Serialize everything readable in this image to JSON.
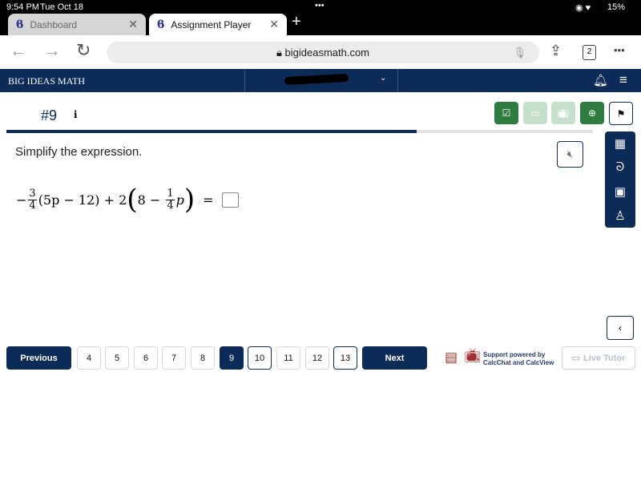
{
  "status_bar": {
    "time": "9:54 PM",
    "date": "Tue Oct 18",
    "battery": "15%"
  },
  "tabs": [
    {
      "label": "Dashboard",
      "active": false
    },
    {
      "label": "Assignment Player",
      "active": true
    }
  ],
  "address_bar": {
    "url": "bigideasmath.com",
    "tab_count": "2"
  },
  "header": {
    "brand": "BIG IDEAS MATH"
  },
  "question": {
    "number": "#9",
    "info": "i",
    "prompt": "Simplify the expression.",
    "progress_percent": 70,
    "math": {
      "lead": "−",
      "f1_num": "3",
      "f1_den": "4",
      "part1": "(5p − 12) + 2",
      "part2": "8 − ",
      "f2_num": "1",
      "f2_den": "4",
      "var": "p",
      "eq": "="
    }
  },
  "pagination": {
    "previous": "Previous",
    "next": "Next",
    "pages": [
      "4",
      "5",
      "6",
      "7",
      "8",
      "9",
      "10",
      "11",
      "12",
      "13"
    ],
    "current": "9"
  },
  "support": {
    "text1": "Support powered by",
    "text2": "CalcChat and CalcView",
    "live_tutor": "Live Tutor"
  },
  "colors": {
    "navy": "#0c2b56",
    "green": "#2e7d3e",
    "green_disabled": "#c6dfc9",
    "support_red": "#a3302c"
  }
}
